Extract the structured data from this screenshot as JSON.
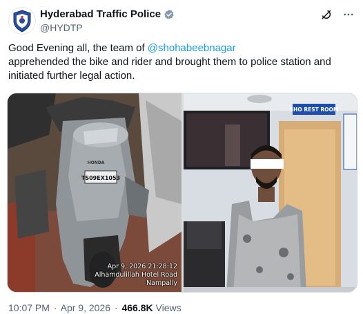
{
  "tweet": {
    "display_name": "Hyderabad Traffic Police",
    "handle": "@HYDTP",
    "text_part1": "Good Evening all, the team of ",
    "mention": "@shohabeebnagar",
    "text_part2": "apprehended the bike and rider and brought them to police station and initiated further legal action.",
    "time": "10:07 PM",
    "separator": "·",
    "date": "Apr 9, 2026",
    "views_count": "466.8K",
    "views_label": "Views"
  },
  "media": {
    "left_photo": {
      "stamp_line1": "Apr 9, 2026 21:28:12",
      "stamp_line2": "Alhamdulillah Hotel Road",
      "stamp_line3": "Nampally",
      "number_plate": "TS09EX1053",
      "brand": "HONDA"
    },
    "right_photo": {
      "sign_text": "SHO REST ROOM"
    }
  },
  "icons": {
    "verified": "verified-badge-icon",
    "grok": "grok-icon",
    "more": "more-icon",
    "avatar": "police-logo-avatar"
  },
  "colors": {
    "mention": "#1d9bf0",
    "verified": "#829aab",
    "secondary_text": "#536471"
  }
}
